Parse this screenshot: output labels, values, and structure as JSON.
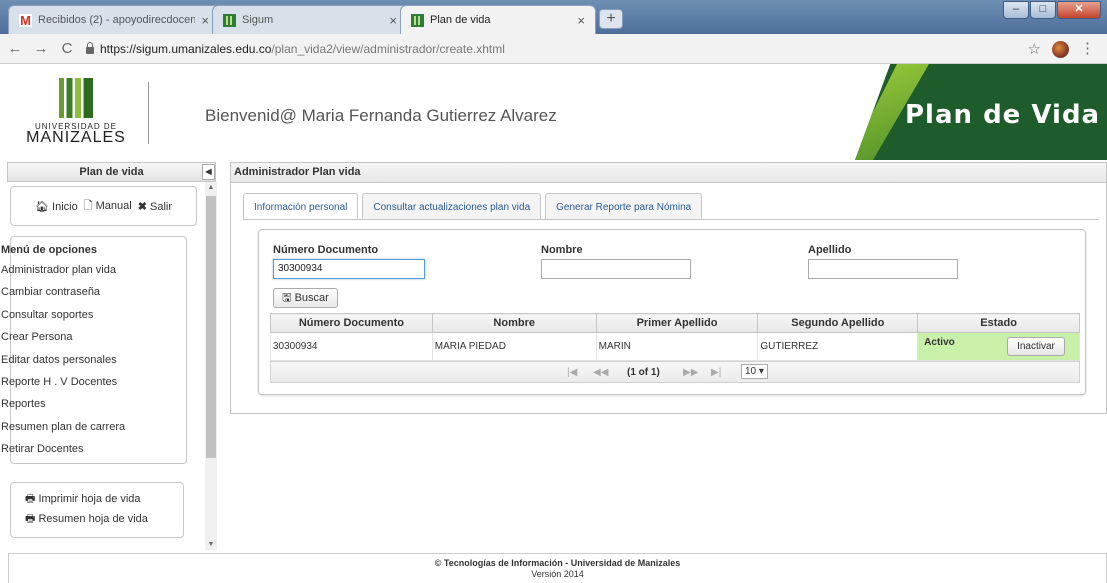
{
  "browser": {
    "tabs": [
      {
        "title": "Recibidos (2) - apoyodirecdocen",
        "icon": "gmail-icon"
      },
      {
        "title": "Sigum",
        "icon": "sigum-icon"
      },
      {
        "title": "Plan de vida",
        "icon": "sigum-icon"
      }
    ],
    "url_host": "https://sigum.umanizales.edu.co",
    "url_path": "/plan_vida2/view/administrador/create.xhtml"
  },
  "header": {
    "logo_line1": "UNIVERSIDAD DE",
    "logo_line2": "MANIZALES",
    "welcome": "Bienvenid@ Maria Fernanda Gutierrez Alvarez",
    "banner": "Plan de Vida"
  },
  "sidebar": {
    "title": "Plan de vida",
    "top_buttons": [
      "Inicio",
      "Manual",
      "Salir"
    ],
    "menu_title": "Menú de opciones",
    "menu_items": [
      "Administrador plan vida",
      "Cambiar contraseña",
      "Consultar soportes",
      "Crear Persona",
      "Editar datos personales",
      "Reporte H . V Docentes",
      "Reportes",
      "Resumen plan de carrera",
      "Retirar Docentes"
    ],
    "print_items": [
      "Imprimir hoja de vida",
      "Resumen hoja de vida"
    ]
  },
  "main": {
    "title": "Administrador Plan vida",
    "tabs": [
      "Información personal",
      "Consultar actualizaciones plan vida",
      "Generar Reporte para Nómina"
    ],
    "search": {
      "doc_label": "Número Documento",
      "doc_value": "30300934",
      "name_label": "Nombre",
      "name_value": "",
      "surname_label": "Apellido",
      "surname_value": "",
      "button": "Buscar"
    },
    "table": {
      "headers": [
        "Número Documento",
        "Nombre",
        "Primer Apellido",
        "Segundo Apellido",
        "Estado"
      ],
      "rows": [
        {
          "doc": "30300934",
          "nombre": "MARIA PIEDAD",
          "apellido1": "MARIN",
          "apellido2": "GUTIERREZ",
          "estado": "Activo",
          "action": "Inactivar"
        }
      ]
    },
    "pager": {
      "first": "|◀",
      "prev": "◀◀",
      "current": "(1 of 1)",
      "next": "▶▶",
      "last": "▶|",
      "rows_per_page": "10 ▾"
    }
  },
  "footer": {
    "line1": "© Tecnologías de Información - Universidad de Manizales",
    "line2": "Versión 2014"
  },
  "colors": {
    "accent_green": "#1f5c2c",
    "active_row": "#c8f0a8",
    "tab_link": "#2a5b8f"
  }
}
